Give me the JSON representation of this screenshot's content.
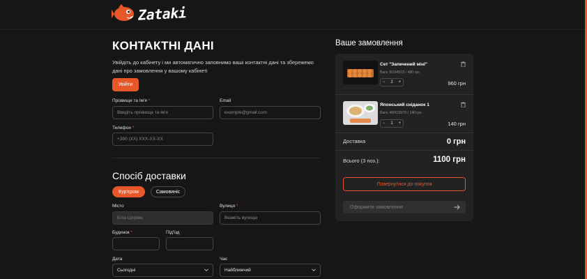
{
  "brand": {
    "logo_text": "Zataki",
    "accent": "#e8572a"
  },
  "contact": {
    "title": "КОНТАКТНІ ДАНІ",
    "info": "Увійдіть до кабінету і ми автоматично заповнимо ваші контактні дані та збережемо дані про замовлення у вашому кабінеті",
    "login_label": "Увійти",
    "name_label": "Прізвище та Ім'я",
    "name_placeholder": "Введіть прізвище та ім'я",
    "email_label": "Email",
    "email_placeholder": "example@gmail.com",
    "phone_label": "Телефон",
    "phone_placeholder": "+380 (XX) XXX-XX-XX",
    "required_mark": "*"
  },
  "delivery": {
    "title": "Спосіб доставки",
    "options": [
      "Кур'єром",
      "Самовиніс"
    ],
    "selected": "Кур'єром",
    "city_label": "Місто",
    "city_value": "Біла Церква",
    "street_label": "Вулиця",
    "street_placeholder": "Вкажіть вулицю",
    "house_label": "Будинок",
    "entrance_label": "Під'їзд",
    "date_label": "Дата",
    "date_value": "Сьогодні",
    "time_label": "Час",
    "time_value": "Найближчий"
  },
  "order": {
    "title": "Ваше замовлення",
    "items": [
      {
        "name": "Сет \"Запечений міні\"",
        "meta": "Вага: 810/45/15 / 480 грн",
        "qty": "2",
        "price": "960 грн"
      },
      {
        "name": "Японський сніданок 1",
        "meta": "Вага: 400/130/70 / 140 грн",
        "qty": "1",
        "price": "140 грн"
      }
    ],
    "delivery_label": "Доставка",
    "delivery_value": "0 грн",
    "total_label": "Всього (3 поз.):",
    "total_value": "1100 грн",
    "back_label": "Повернутися до покупок",
    "checkout_label": "Оформити замовлення",
    "minus": "−",
    "plus": "+"
  }
}
